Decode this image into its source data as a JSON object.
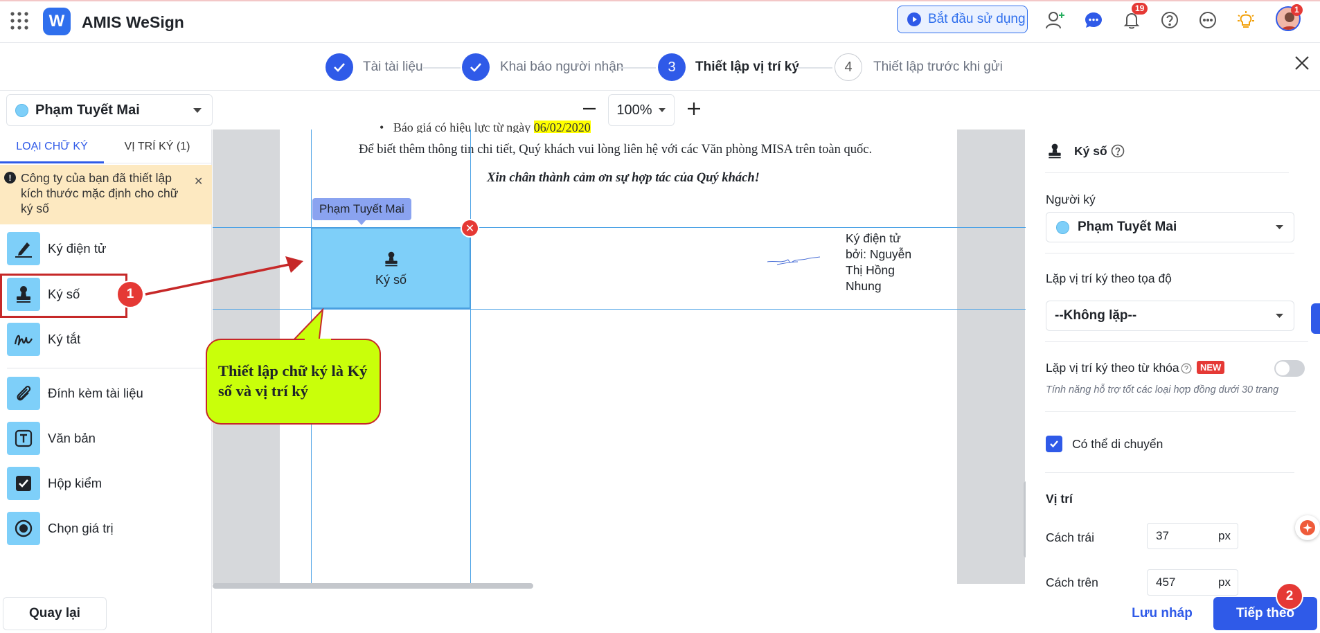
{
  "app": {
    "title": "AMIS WeSign",
    "logo_letter": "W"
  },
  "topbar": {
    "start_label": "Bắt đầu sử dụng",
    "notifications_count": "19",
    "avatar_badge": "1"
  },
  "stepper": {
    "steps": [
      {
        "label": "Tài tài liệu",
        "number": "",
        "state": "done"
      },
      {
        "label": "Khai báo người nhận",
        "number": "",
        "state": "done"
      },
      {
        "label": "Thiết lập vị trí ký",
        "number": "3",
        "state": "active"
      },
      {
        "label": "Thiết lập trước khi gửi",
        "number": "4",
        "state": "todo"
      }
    ]
  },
  "toolbar": {
    "recipient": "Phạm Tuyết Mai",
    "zoom": "100%"
  },
  "left_panel": {
    "tabs": [
      "LOẠI CHỮ KÝ",
      "VỊ TRÍ KÝ (1)"
    ],
    "notice": "Công ty của bạn đã thiết lập kích thước mặc định cho chữ ký số",
    "tools": [
      {
        "label": "Ký điện tử",
        "icon": "pen-sign-icon"
      },
      {
        "label": "Ký số",
        "icon": "stamp-icon"
      },
      {
        "label": "Ký tắt",
        "icon": "initials-icon"
      },
      {
        "label": "Đính kèm tài liệu",
        "icon": "paperclip-icon"
      },
      {
        "label": "Văn bản",
        "icon": "text-icon"
      },
      {
        "label": "Hộp kiểm",
        "icon": "checkbox-icon"
      },
      {
        "label": "Chọn giá trị",
        "icon": "radio-icon"
      }
    ],
    "back_label": "Quay lại"
  },
  "document": {
    "line_top_cut": "Báo giá có hiệu lực từ ngày",
    "line_top_date": "06/02/2020",
    "line1": "Để biết thêm thông tin chi tiết, Quý khách vui lòng liên hệ với các Văn phòng MISA trên toàn quốc.",
    "line2": "Xin chân thành cảm ơn sự hợp tác của Quý khách!",
    "sig_tag": "Phạm Tuyết Mai",
    "sig_label": "Ký số",
    "signed_by": [
      "Ký điện tử",
      "bởi: Nguyễn",
      "Thị Hồng",
      "Nhung"
    ]
  },
  "annotations": {
    "callout": "Thiết lập chữ ký là Ký số và vị trí ký",
    "badge1": "1",
    "badge2": "2",
    "colors": {
      "highlight": "#c62828",
      "callout_fill": "#c9ff0a"
    }
  },
  "right_panel": {
    "header": "Ký số",
    "signer_label": "Người ký",
    "signer_value": "Phạm Tuyết Mai",
    "repeat_coord_label": "Lặp vị trí ký theo tọa độ",
    "repeat_coord_value": "--Không lặp--",
    "repeat_keyword_label": "Lặp vị trí ký theo từ khóa",
    "new_badge": "NEW",
    "keyword_hint": "Tính năng hỗ trợ tốt các loại hợp đồng dưới 30 trang",
    "movable_label": "Có thể di chuyển",
    "position_title": "Vị trí",
    "left_label": "Cách trái",
    "left_value": "37",
    "top_label": "Cách trên",
    "top_value": "457",
    "unit": "px",
    "keyword_toggle_on": false,
    "movable_checked": true
  },
  "footer": {
    "save_draft": "Lưu nháp",
    "next": "Tiếp theo"
  }
}
